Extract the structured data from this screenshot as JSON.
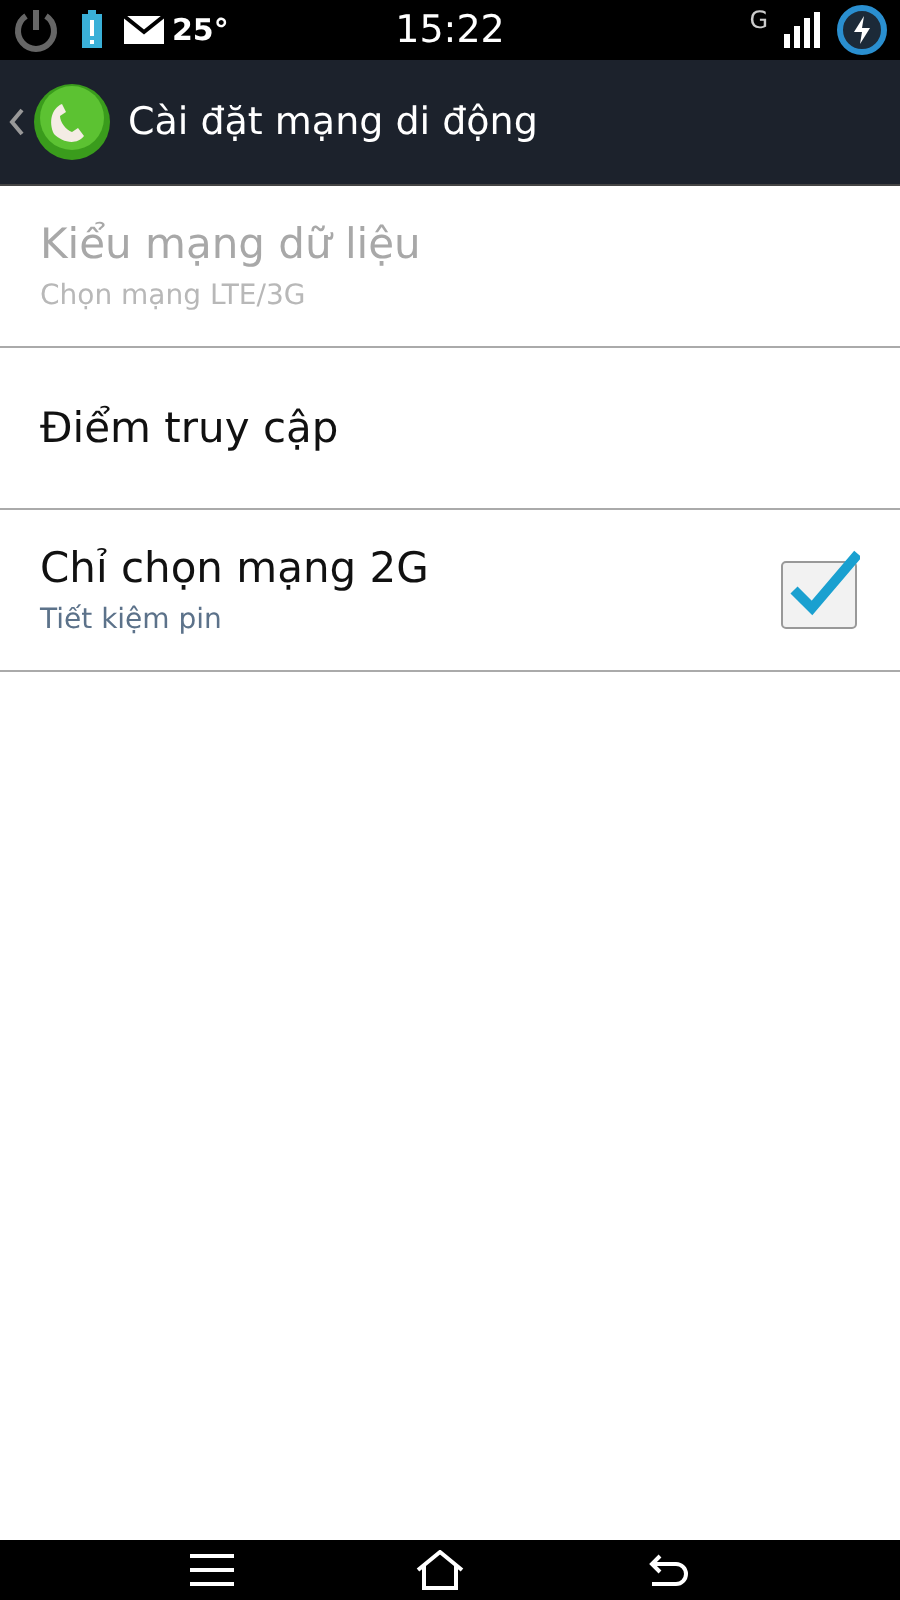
{
  "status_bar": {
    "temperature": "25°",
    "time": "15:22",
    "network_type": "G"
  },
  "action_bar": {
    "title": "Cài đặt mạng di động"
  },
  "settings": [
    {
      "kind": "plain",
      "title": "Kiểu mạng dữ liệu",
      "summary": "Chọn mạng LTE/3G",
      "disabled": true
    },
    {
      "kind": "plain",
      "title": "Điểm truy cập",
      "disabled": false
    },
    {
      "kind": "checkbox",
      "title": "Chỉ chọn mạng 2G",
      "summary": "Tiết kiệm pin",
      "disabled": false,
      "checked": true
    }
  ]
}
